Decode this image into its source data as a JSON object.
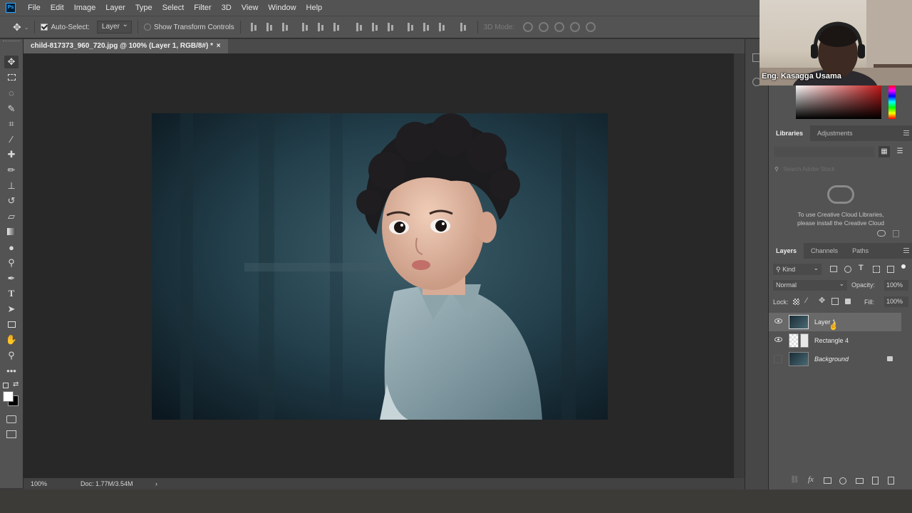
{
  "menu": [
    "File",
    "Edit",
    "Image",
    "Layer",
    "Type",
    "Select",
    "Filter",
    "3D",
    "View",
    "Window",
    "Help"
  ],
  "app_logo": "Ps",
  "options": {
    "auto_select_label": "Auto-Select:",
    "auto_select_checked": true,
    "auto_select_target": "Layer",
    "transform_controls_label": "Show Transform Controls",
    "mode_3d_label": "3D Mode:"
  },
  "document": {
    "tab_title": "child-817373_960_720.jpg @ 100% (Layer 1, RGB/8#) *",
    "close_glyph": "×",
    "zoom": "100%",
    "doc_size": "Doc: 1.77M/3.54M",
    "status_arrow": "›"
  },
  "webcam": {
    "presenter_name": "Eng. Kasagga Usama"
  },
  "libraries_panel": {
    "tabs": [
      "Libraries",
      "Adjustments"
    ],
    "active_tab": "Libraries",
    "search_placeholder": "Search Adobe Stock",
    "message_line1": "To use Creative Cloud Libraries,",
    "message_line2": "please install the Creative Cloud"
  },
  "layers_panel": {
    "tabs": [
      "Layers",
      "Channels",
      "Paths"
    ],
    "active_tab": "Layers",
    "filter_kind": "Kind",
    "blend_mode": "Normal",
    "opacity_label": "Opacity:",
    "opacity_value": "100%",
    "lock_label": "Lock:",
    "fill_label": "Fill:",
    "fill_value": "100%",
    "layers": [
      {
        "name": "Layer 1",
        "visible": true,
        "selected": true,
        "locked": false
      },
      {
        "name": "Rectangle 4",
        "visible": true,
        "selected": false,
        "locked": false
      },
      {
        "name": "Background",
        "visible": false,
        "selected": false,
        "locked": true
      }
    ]
  },
  "colors": {
    "ui_dark": "#535353",
    "canvas_bg": "#282828",
    "accent": "#31a8ff"
  }
}
